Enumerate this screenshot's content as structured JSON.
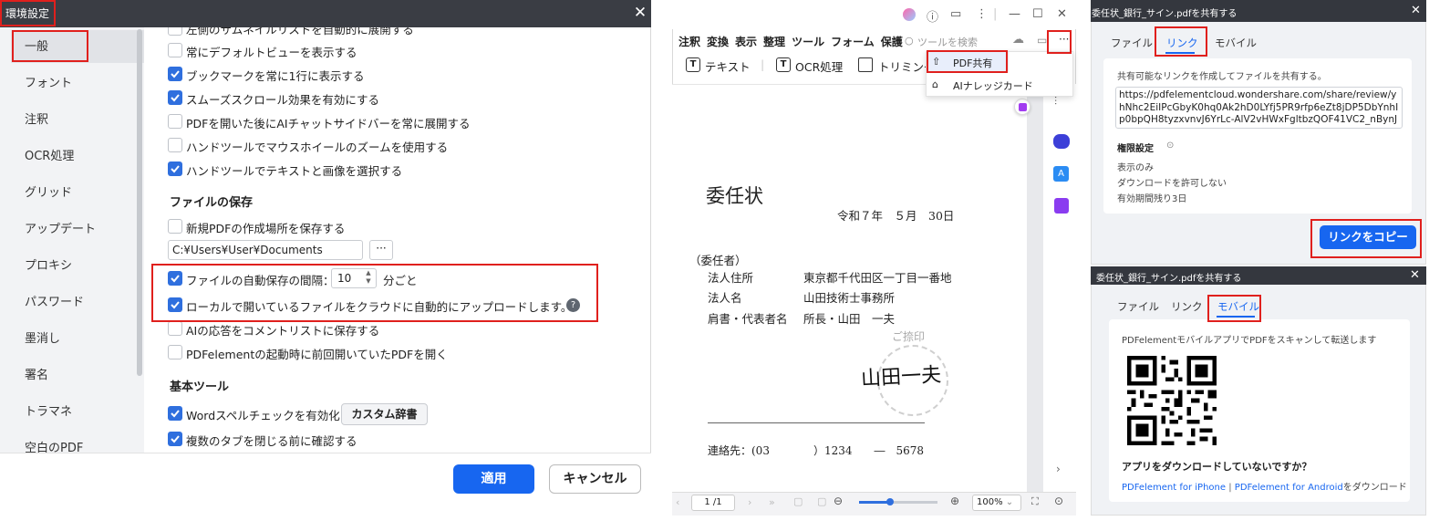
{
  "settings": {
    "title": "環境設定",
    "close": "✕",
    "sidebar": [
      "一般",
      "フォント",
      "注釈",
      "OCR処理",
      "グリッド",
      "アップデート",
      "プロキシ",
      "パスワード",
      "墨消し",
      "署名",
      "トラマネ",
      "空白のPDF"
    ],
    "options": [
      {
        "label": "左側のサムネイルリストを自動的に展開する",
        "checked": false
      },
      {
        "label": "常にデフォルトビューを表示する",
        "checked": false
      },
      {
        "label": "ブックマークを常に1行に表示する",
        "checked": true
      },
      {
        "label": "スムーズスクロール効果を有効にする",
        "checked": true
      },
      {
        "label": "PDFを開いた後にAIチャットサイドバーを常に展開する",
        "checked": false
      },
      {
        "label": "ハンドツールでマウスホイールのズームを使用する",
        "checked": false
      },
      {
        "label": "ハンドツールでテキストと画像を選択する",
        "checked": true
      }
    ],
    "save_section": "ファイルの保存",
    "save_new_location": "新規PDFの作成場所を保存する",
    "path": "C:¥Users¥User¥Documents",
    "path_button": "···",
    "autosave_label": "ファイルの自動保存の間隔：",
    "autosave_value": "10",
    "autosave_unit": "分ごと",
    "cloud_upload": "ローカルで開いているファイルをクラウドに自動的にアップロードします。",
    "help": "?",
    "more_options": [
      {
        "label": "AIの応答をコメントリストに保存する",
        "checked": false
      },
      {
        "label": "PDFelementの起動時に前回開いていたPDFを開く",
        "checked": false
      }
    ],
    "basic_section": "基本ツール",
    "spellcheck": "Wordスペルチェックを有効化",
    "dict_button": "カスタム辞書",
    "confirm_tabs": "複数のタブを閉じる前に確認する",
    "apply": "適用",
    "cancel": "キャンセル"
  },
  "editor": {
    "menu": [
      "注釈",
      "変換",
      "表示",
      "整理",
      "ツール",
      "フォーム",
      "保護"
    ],
    "search_placeholder": "ツールを検索",
    "tools": [
      "テキスト",
      "OCR処理",
      "トリミング"
    ],
    "more": "···",
    "popup": [
      "PDF共有",
      "AIナレッジカード"
    ],
    "doc": {
      "title": "委任状",
      "date": "令和７年　５月　30日",
      "principal": "（委任者）",
      "address_label": "法人住所",
      "address": "東京都千代田区一丁目一番地",
      "name_label": "法人名",
      "name": "山田技術士事務所",
      "rep_label": "肩書・代表者名",
      "rep": "所長・山田　一夫",
      "seal_note": "ご捺印",
      "signature": "山田一夫",
      "contact": "連絡先：(03　　　　）1234　　―　5678"
    },
    "page": "1 /1",
    "zoom": "100%",
    "zoom_fraction": 0.4
  },
  "share_link": {
    "title": "委任状_銀行_サイン.pdfを共有する",
    "tabs": [
      "ファイル",
      "リンク",
      "モバイル"
    ],
    "description": "共有可能なリンクを作成してファイルを共有する。",
    "url": "https://pdfelementcloud.wondershare.com/share/review/yhNhc2EiIPcGbyK0hq0Ak2hD0LYfj5PR9rfp6eZt8jDP5DbYnhIp0bpQH8tyzxvnvJ6YrLc-AlV2vHWxFgltbzQOF41VC2_nBynJbAviSxw",
    "permission_title": "権限設定",
    "permissions": [
      "表示のみ",
      "ダウンロードを許可しない",
      "有効期間残り3日"
    ],
    "copy": "リンクをコピー"
  },
  "share_mobile": {
    "title": "委任状_銀行_サイン.pdfを共有する",
    "tabs": [
      "ファイル",
      "リンク",
      "モバイル"
    ],
    "description": "PDFelementモバイルアプリでPDFをスキャンして転送します",
    "question": "アプリをダウンロードしていないですか？",
    "iphone": "PDFelement for iPhone",
    "separator": "|",
    "android": "PDFelement for Android",
    "suffix": "をダウンロード"
  }
}
